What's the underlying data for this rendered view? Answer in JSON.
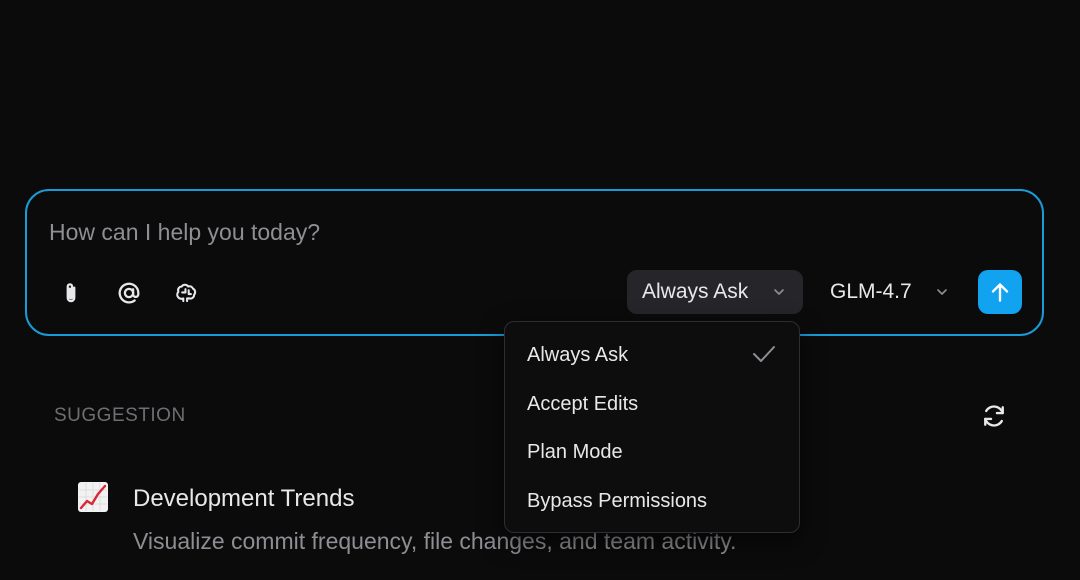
{
  "composer": {
    "placeholder": "How can I help you today?",
    "tools": [
      {
        "icon": "paperclip-icon"
      },
      {
        "icon": "at-sign-icon"
      },
      {
        "icon": "brain-icon"
      }
    ],
    "mode_select": {
      "value": "Always Ask"
    },
    "model_select": {
      "value": "GLM-4.7"
    },
    "send": {
      "icon": "arrow-up-icon",
      "color": "#12a3f0"
    },
    "border_color": "#1a9bd7"
  },
  "mode_menu": {
    "items": [
      {
        "label": "Always Ask",
        "selected": true
      },
      {
        "label": "Accept Edits",
        "selected": false
      },
      {
        "label": "Plan Mode",
        "selected": false
      },
      {
        "label": "Bypass Permissions",
        "selected": false
      }
    ]
  },
  "suggestions": {
    "header": "SUGGESTION",
    "refresh_icon": "refresh-icon",
    "items": [
      {
        "icon": "chart-increasing-icon",
        "title": "Development Trends",
        "description": "Visualize commit frequency, file changes, and team activity."
      }
    ]
  }
}
